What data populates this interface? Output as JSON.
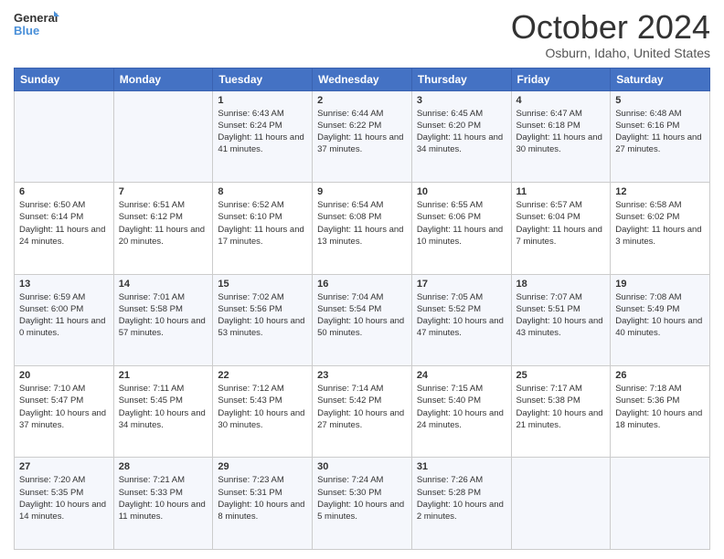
{
  "header": {
    "logo_line1": "General",
    "logo_line2": "Blue",
    "month": "October 2024",
    "location": "Osburn, Idaho, United States"
  },
  "days_of_week": [
    "Sunday",
    "Monday",
    "Tuesday",
    "Wednesday",
    "Thursday",
    "Friday",
    "Saturday"
  ],
  "weeks": [
    [
      {
        "day": "",
        "info": ""
      },
      {
        "day": "",
        "info": ""
      },
      {
        "day": "1",
        "info": "Sunrise: 6:43 AM\nSunset: 6:24 PM\nDaylight: 11 hours and 41 minutes."
      },
      {
        "day": "2",
        "info": "Sunrise: 6:44 AM\nSunset: 6:22 PM\nDaylight: 11 hours and 37 minutes."
      },
      {
        "day": "3",
        "info": "Sunrise: 6:45 AM\nSunset: 6:20 PM\nDaylight: 11 hours and 34 minutes."
      },
      {
        "day": "4",
        "info": "Sunrise: 6:47 AM\nSunset: 6:18 PM\nDaylight: 11 hours and 30 minutes."
      },
      {
        "day": "5",
        "info": "Sunrise: 6:48 AM\nSunset: 6:16 PM\nDaylight: 11 hours and 27 minutes."
      }
    ],
    [
      {
        "day": "6",
        "info": "Sunrise: 6:50 AM\nSunset: 6:14 PM\nDaylight: 11 hours and 24 minutes."
      },
      {
        "day": "7",
        "info": "Sunrise: 6:51 AM\nSunset: 6:12 PM\nDaylight: 11 hours and 20 minutes."
      },
      {
        "day": "8",
        "info": "Sunrise: 6:52 AM\nSunset: 6:10 PM\nDaylight: 11 hours and 17 minutes."
      },
      {
        "day": "9",
        "info": "Sunrise: 6:54 AM\nSunset: 6:08 PM\nDaylight: 11 hours and 13 minutes."
      },
      {
        "day": "10",
        "info": "Sunrise: 6:55 AM\nSunset: 6:06 PM\nDaylight: 11 hours and 10 minutes."
      },
      {
        "day": "11",
        "info": "Sunrise: 6:57 AM\nSunset: 6:04 PM\nDaylight: 11 hours and 7 minutes."
      },
      {
        "day": "12",
        "info": "Sunrise: 6:58 AM\nSunset: 6:02 PM\nDaylight: 11 hours and 3 minutes."
      }
    ],
    [
      {
        "day": "13",
        "info": "Sunrise: 6:59 AM\nSunset: 6:00 PM\nDaylight: 11 hours and 0 minutes."
      },
      {
        "day": "14",
        "info": "Sunrise: 7:01 AM\nSunset: 5:58 PM\nDaylight: 10 hours and 57 minutes."
      },
      {
        "day": "15",
        "info": "Sunrise: 7:02 AM\nSunset: 5:56 PM\nDaylight: 10 hours and 53 minutes."
      },
      {
        "day": "16",
        "info": "Sunrise: 7:04 AM\nSunset: 5:54 PM\nDaylight: 10 hours and 50 minutes."
      },
      {
        "day": "17",
        "info": "Sunrise: 7:05 AM\nSunset: 5:52 PM\nDaylight: 10 hours and 47 minutes."
      },
      {
        "day": "18",
        "info": "Sunrise: 7:07 AM\nSunset: 5:51 PM\nDaylight: 10 hours and 43 minutes."
      },
      {
        "day": "19",
        "info": "Sunrise: 7:08 AM\nSunset: 5:49 PM\nDaylight: 10 hours and 40 minutes."
      }
    ],
    [
      {
        "day": "20",
        "info": "Sunrise: 7:10 AM\nSunset: 5:47 PM\nDaylight: 10 hours and 37 minutes."
      },
      {
        "day": "21",
        "info": "Sunrise: 7:11 AM\nSunset: 5:45 PM\nDaylight: 10 hours and 34 minutes."
      },
      {
        "day": "22",
        "info": "Sunrise: 7:12 AM\nSunset: 5:43 PM\nDaylight: 10 hours and 30 minutes."
      },
      {
        "day": "23",
        "info": "Sunrise: 7:14 AM\nSunset: 5:42 PM\nDaylight: 10 hours and 27 minutes."
      },
      {
        "day": "24",
        "info": "Sunrise: 7:15 AM\nSunset: 5:40 PM\nDaylight: 10 hours and 24 minutes."
      },
      {
        "day": "25",
        "info": "Sunrise: 7:17 AM\nSunset: 5:38 PM\nDaylight: 10 hours and 21 minutes."
      },
      {
        "day": "26",
        "info": "Sunrise: 7:18 AM\nSunset: 5:36 PM\nDaylight: 10 hours and 18 minutes."
      }
    ],
    [
      {
        "day": "27",
        "info": "Sunrise: 7:20 AM\nSunset: 5:35 PM\nDaylight: 10 hours and 14 minutes."
      },
      {
        "day": "28",
        "info": "Sunrise: 7:21 AM\nSunset: 5:33 PM\nDaylight: 10 hours and 11 minutes."
      },
      {
        "day": "29",
        "info": "Sunrise: 7:23 AM\nSunset: 5:31 PM\nDaylight: 10 hours and 8 minutes."
      },
      {
        "day": "30",
        "info": "Sunrise: 7:24 AM\nSunset: 5:30 PM\nDaylight: 10 hours and 5 minutes."
      },
      {
        "day": "31",
        "info": "Sunrise: 7:26 AM\nSunset: 5:28 PM\nDaylight: 10 hours and 2 minutes."
      },
      {
        "day": "",
        "info": ""
      },
      {
        "day": "",
        "info": ""
      }
    ]
  ]
}
